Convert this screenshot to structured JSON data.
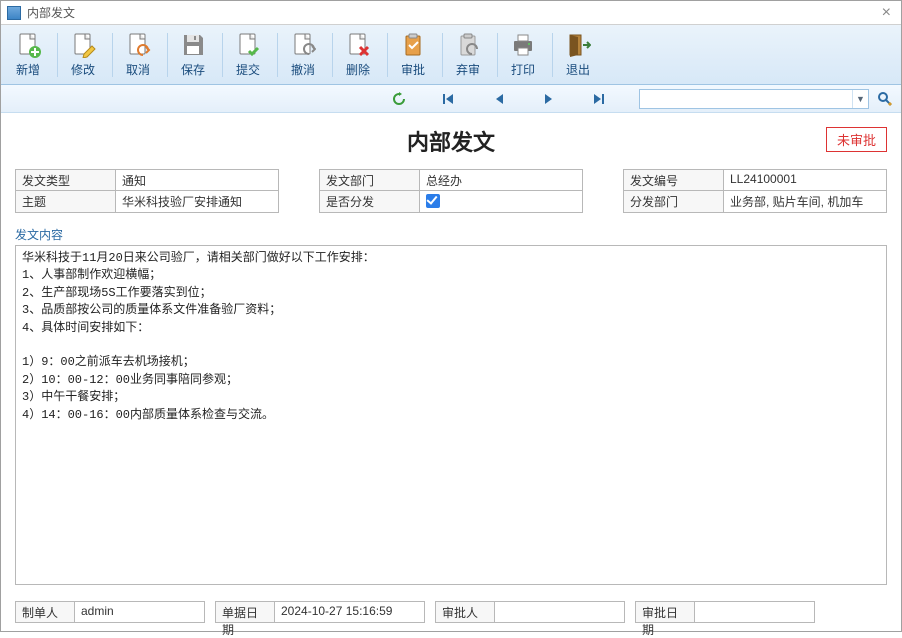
{
  "window": {
    "title": "内部发文"
  },
  "toolbar": {
    "new": "新增",
    "edit": "修改",
    "cancel": "取消",
    "save": "保存",
    "submit": "提交",
    "revoke": "撤消",
    "delete": "删除",
    "approve": "审批",
    "abandon": "弃审",
    "print": "打印",
    "exit": "退出"
  },
  "navbar": {
    "search_value": "",
    "search_placeholder": ""
  },
  "document": {
    "title": "内部发文",
    "status": "未审批"
  },
  "labels": {
    "doc_type": "发文类型",
    "subject": "主题",
    "dept": "发文部门",
    "distribute_flag": "是否分发",
    "doc_no": "发文编号",
    "distribute_dept": "分发部门",
    "content": "发文内容",
    "creator": "制单人",
    "bill_date": "单据日期",
    "approver": "审批人",
    "approve_date": "审批日期"
  },
  "fields": {
    "doc_type": "通知",
    "subject": "华米科技验厂安排通知",
    "dept": "总经办",
    "distribute_flag": true,
    "doc_no": "LL24100001",
    "distribute_dept": "业务部, 贴片车间, 机加车",
    "content": "华米科技于11月20日来公司验厂，请相关部门做好以下工作安排：\n1、人事部制作欢迎横幅；\n2、生产部现场5S工作要落实到位；\n3、品质部按公司的质量体系文件准备验厂资料；\n4、具体时间安排如下：\n\n1）9：00之前派车去机场接机；\n2）10：00-12：00业务同事陪同参观；\n3）中午干餐安排；\n4）14：00-16：00内部质量体系检查与交流。",
    "creator": "admin",
    "bill_date": "2024-10-27 15:16:59",
    "approver": "",
    "approve_date": ""
  },
  "colors": {
    "accent": "#2b6aa3",
    "danger": "#d33"
  }
}
